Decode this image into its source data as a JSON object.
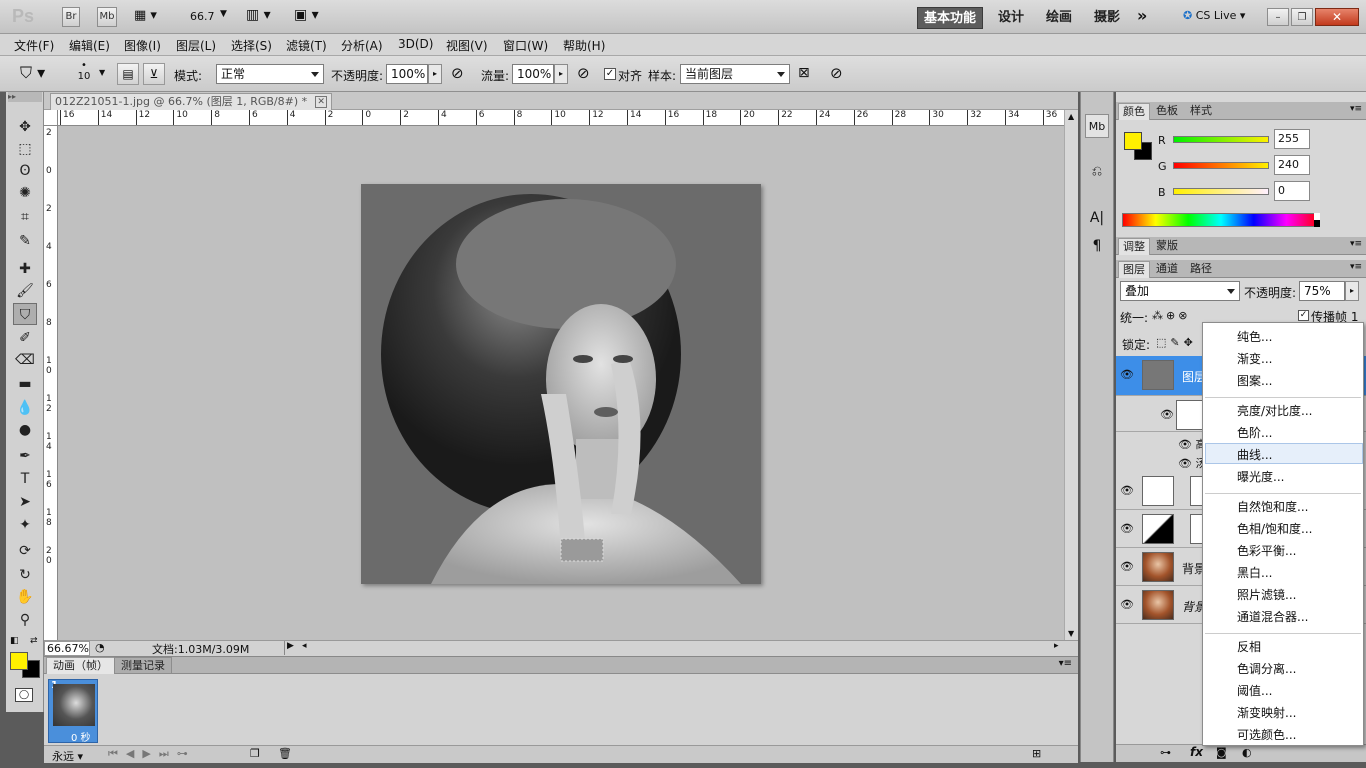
{
  "appbar": {
    "logo": "Ps",
    "bridge": "Br",
    "minibridge": "Mb",
    "zoom": "66.7",
    "workspaces": [
      "基本功能",
      "设计",
      "绘画",
      "摄影"
    ],
    "more": "»",
    "cslive": "CS Live"
  },
  "menu": [
    "文件(F)",
    "编辑(E)",
    "图像(I)",
    "图层(L)",
    "选择(S)",
    "滤镜(T)",
    "分析(A)",
    "3D(D)",
    "视图(V)",
    "窗口(W)",
    "帮助(H)"
  ],
  "options": {
    "brush_size": "10",
    "mode_label": "模式:",
    "mode_value": "正常",
    "opacity_label": "不透明度:",
    "opacity_value": "100%",
    "flow_label": "流量:",
    "flow_value": "100%",
    "align_label": "对齐",
    "sample_label": "样本:",
    "sample_value": "当前图层"
  },
  "document": {
    "tab_title": "012Z21051-1.jpg @ 66.7% (图层 1, RGB/8#) *",
    "ruler_h": [
      "16",
      "14",
      "12",
      "10",
      "8",
      "6",
      "4",
      "2",
      "0",
      "2",
      "4",
      "6",
      "8",
      "10",
      "12",
      "14",
      "16",
      "18",
      "20",
      "22",
      "24",
      "26",
      "28",
      "30",
      "32",
      "34",
      "36"
    ],
    "ruler_v": [
      "2",
      "0",
      "2",
      "4",
      "6",
      "8",
      "1\n0",
      "1\n2",
      "1\n4",
      "1\n6",
      "1\n8",
      "2\n0"
    ],
    "zoom_status": "66.67%",
    "doc_status": "文档:1.03M/3.09M"
  },
  "anim": {
    "tabs": [
      "动画（帧）",
      "测量记录"
    ],
    "frame_number": "1",
    "frame_delay": "0 秒",
    "loop": "永远"
  },
  "color_panel": {
    "tabs": [
      "颜色",
      "色板",
      "样式"
    ],
    "r_label": "R",
    "r_value": "255",
    "g_label": "G",
    "g_value": "240",
    "b_label": "B",
    "b_value": "0",
    "foreground": "#fff000",
    "background": "#000000"
  },
  "adjust_panel": {
    "tabs": [
      "调整",
      "蒙版"
    ]
  },
  "layers_panel": {
    "tabs": [
      "图层",
      "通道",
      "路径"
    ],
    "blend_mode": "叠加",
    "opacity_label": "不透明度:",
    "opacity_value": "75%",
    "unify_label": "统一:",
    "propagate_label": "传播帧 1",
    "lock_label": "锁定:",
    "layer1": "图层",
    "sub1": "高",
    "sub2": "汤",
    "bg1": "背景",
    "bg2": "背景"
  },
  "context_menu": {
    "items": [
      "纯色...",
      "渐变...",
      "图案...",
      "亮度/对比度...",
      "色阶...",
      "曲线...",
      "曝光度...",
      "自然饱和度...",
      "色相/饱和度...",
      "色彩平衡...",
      "黑白...",
      "照片滤镜...",
      "通道混合器...",
      "反相",
      "色调分离...",
      "阈值...",
      "渐变映射...",
      "可选颜色..."
    ],
    "highlighted": "曲线..."
  },
  "icons": {
    "move": "move-icon",
    "marquee": "marquee-icon",
    "lasso": "lasso-icon",
    "quick-select": "quick-select-icon",
    "crop": "crop-icon",
    "eyedropper": "eyedropper-icon",
    "healing": "healing-icon",
    "brush": "brush-icon",
    "clone-stamp": "clone-stamp-icon",
    "history-brush": "history-brush-icon",
    "eraser": "eraser-icon",
    "gradient": "gradient-icon",
    "blur": "blur-icon",
    "dodge": "dodge-icon",
    "pen": "pen-icon",
    "type": "type-icon",
    "path-select": "path-select-icon",
    "shape": "shape-icon",
    "3d-rotate": "3d-rotate-icon",
    "3d-orbit": "3d-orbit-icon",
    "hand": "hand-icon",
    "zoom": "zoom-icon"
  }
}
